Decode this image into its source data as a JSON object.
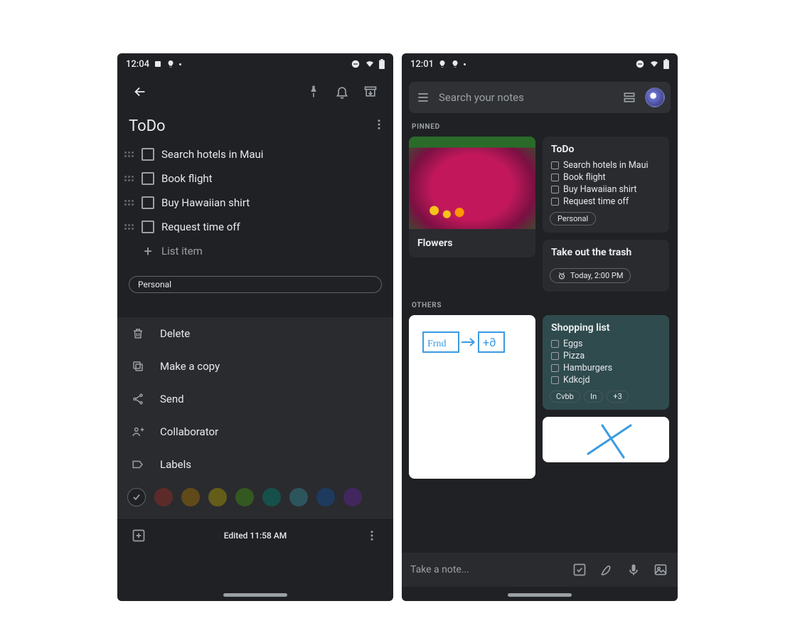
{
  "phoneA": {
    "status": {
      "time": "12:04"
    },
    "note": {
      "title": "ToDo",
      "items": [
        "Search hotels in Maui",
        "Book flight",
        "Buy Hawaiian shirt",
        "Request time off"
      ],
      "add_placeholder": "List item",
      "label_chip": "Personal"
    },
    "menu": {
      "delete": "Delete",
      "copy": "Make a copy",
      "send": "Send",
      "collab": "Collaborator",
      "labels": "Labels"
    },
    "palette": [
      "#202124",
      "#5c2b29",
      "#614a19",
      "#635d19",
      "#345920",
      "#16504b",
      "#2d555e",
      "#1e3a5f",
      "#42275e"
    ],
    "footer": {
      "edited": "Edited 11:58 AM"
    }
  },
  "phoneB": {
    "status": {
      "time": "12:01"
    },
    "search": {
      "placeholder": "Search your notes"
    },
    "sections": {
      "pinned": "PINNED",
      "others": "OTHERS"
    },
    "cards": {
      "flowers": {
        "title": "Flowers"
      },
      "todo": {
        "title": "ToDo",
        "items": [
          "Search hotels in Maui",
          "Book flight",
          "Buy Hawaiian shirt",
          "Request time off"
        ],
        "chip": "Personal"
      },
      "trash": {
        "title": "Take out the trash",
        "reminder": "Today, 2:00 PM"
      },
      "shopping": {
        "title": "Shopping list",
        "items": [
          "Eggs",
          "Pizza",
          "Hamburgers",
          "Kdkcjd"
        ],
        "tags": [
          "Cvbb",
          "In",
          "+3"
        ]
      }
    },
    "bottombar": {
      "placeholder": "Take a note..."
    }
  }
}
